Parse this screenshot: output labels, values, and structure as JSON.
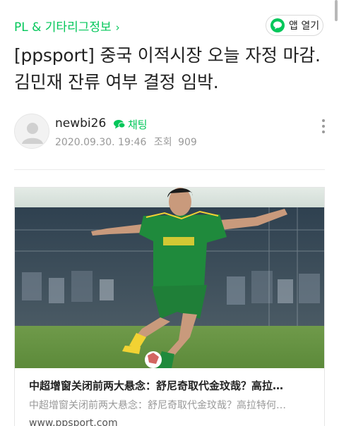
{
  "header": {
    "breadcrumb": "PL & 기타리그정보",
    "breadcrumb_chevron": "›",
    "app_button_label": "앱 열기",
    "accent_color": "#03c75a"
  },
  "article": {
    "title": "[ppsport] 중국 이적시장 오늘 자정 마감. 김민재 잔류 여부 결정 임박.",
    "author": {
      "nickname": "newbi26",
      "chat_label": "채팅",
      "date": "2020.09.30. 19:46",
      "views_label": "조회",
      "views": "909"
    }
  },
  "link_card": {
    "thumbnail_icon": "soccer-player-photo",
    "title": "中超增窗关闭前两大悬念：舒尼奇取代金玟哉？高拉…",
    "description": "中超增窗关闭前两大悬念：舒尼奇取代金玟哉？高拉特何…",
    "url": "www.ppsport.com"
  },
  "icons": {
    "chevron": "chevron-right-icon",
    "app": "chat-bubble-icon",
    "chat": "chat-icon",
    "more": "more-vertical-icon",
    "avatar": "default-avatar-icon"
  }
}
